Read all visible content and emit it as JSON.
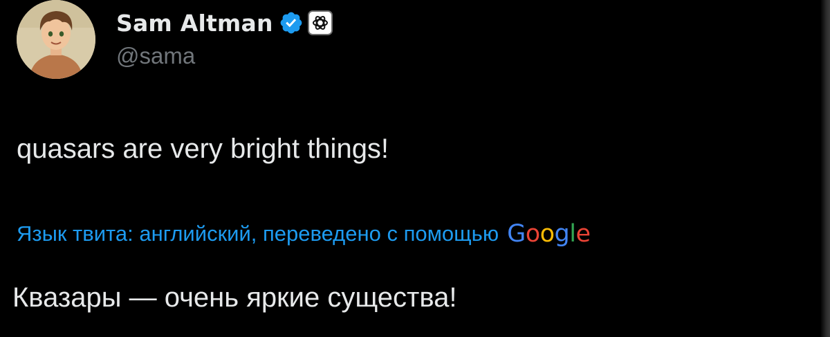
{
  "author": {
    "display_name": "Sam Altman",
    "handle": "@sama",
    "verified_icon": "verified-check-icon",
    "affiliation_icon": "openai-logo-icon"
  },
  "tweet": {
    "text": "quasars are very bright things!"
  },
  "translation": {
    "label": "Язык твита: английский, переведено с помощью",
    "provider_letters": [
      {
        "ch": "G",
        "color": "#4285f4"
      },
      {
        "ch": "o",
        "color": "#ea4335"
      },
      {
        "ch": "o",
        "color": "#fbbc05"
      },
      {
        "ch": "g",
        "color": "#4285f4"
      },
      {
        "ch": "l",
        "color": "#34a853"
      },
      {
        "ch": "e",
        "color": "#ea4335"
      }
    ],
    "translated_text": "Квазары — очень яркие существа!"
  },
  "colors": {
    "background": "#000000",
    "text_primary": "#e7e9ea",
    "text_secondary": "#71767b",
    "accent": "#1d9bf0"
  }
}
